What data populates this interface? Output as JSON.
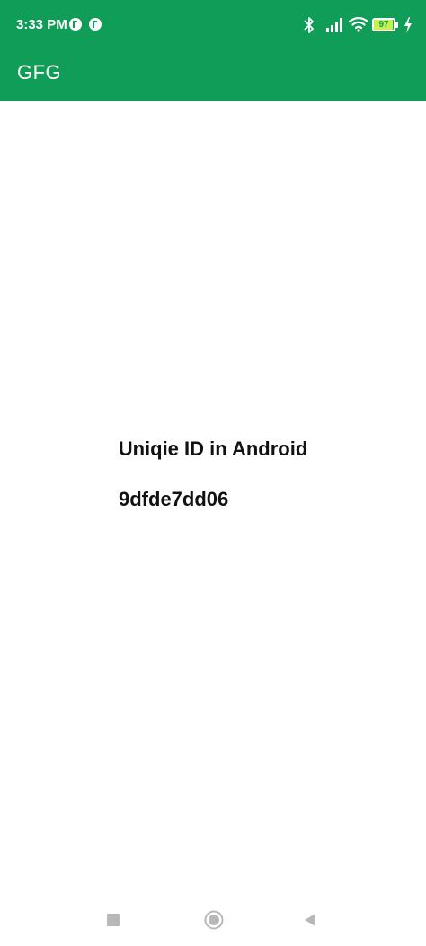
{
  "colors": {
    "brand": "#0F9D58",
    "battery_fill": "#C6F24A",
    "nav_icon": "#B8B8B8"
  },
  "status_bar": {
    "time": "3:33 PM",
    "notifications": [
      "notification-app-icon",
      "notification-app-icon"
    ],
    "battery_level": "97",
    "battery_fraction": 0.97,
    "icons": [
      "bluetooth-icon",
      "signal-icon",
      "wifi-icon",
      "battery-icon",
      "charging-icon"
    ]
  },
  "app_bar": {
    "title": "GFG"
  },
  "main": {
    "heading": "Uniqie ID in Android",
    "unique_id": "9dfde7dd06"
  },
  "nav_bar": {
    "icons": [
      "recents-square-icon",
      "home-circle-icon",
      "back-triangle-icon"
    ]
  }
}
